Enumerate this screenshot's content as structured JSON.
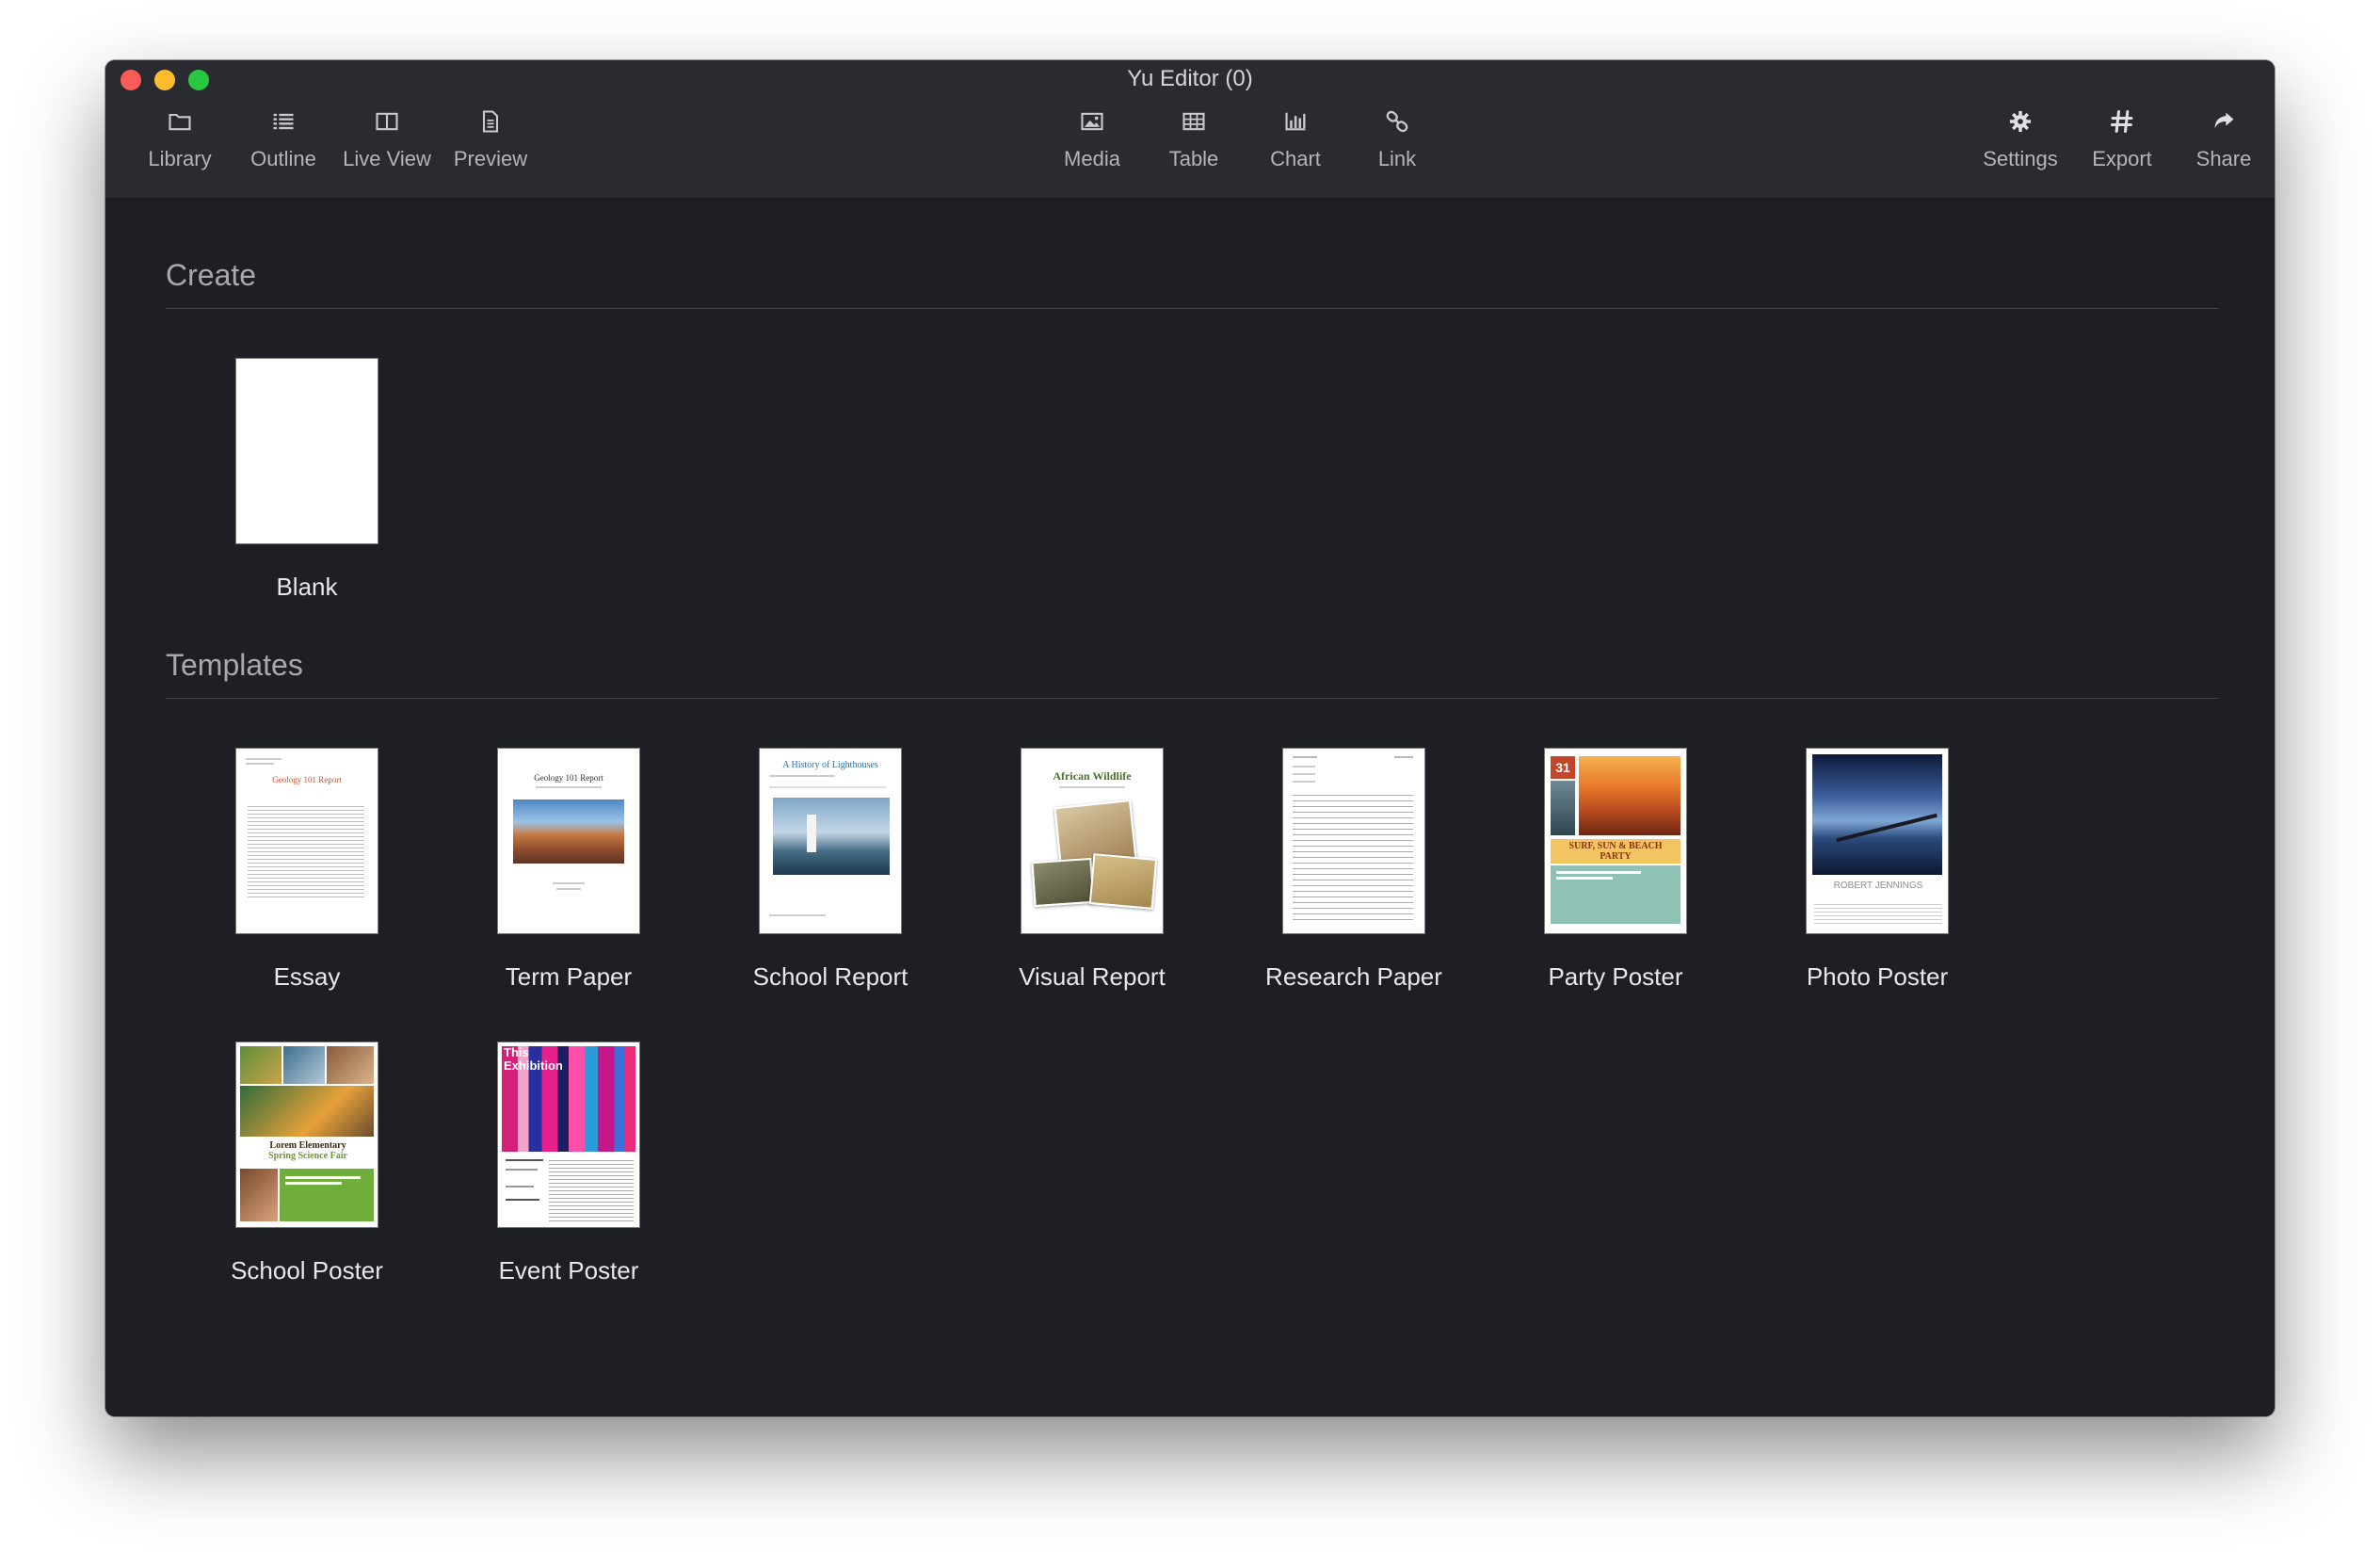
{
  "window": {
    "title": "Yu Editor (0)"
  },
  "toolbar": {
    "left": [
      {
        "label": "Library",
        "icon": "folder-icon"
      },
      {
        "label": "Outline",
        "icon": "outline-list-icon"
      },
      {
        "label": "Live View",
        "icon": "split-view-icon"
      },
      {
        "label": "Preview",
        "icon": "document-icon"
      }
    ],
    "center": [
      {
        "label": "Media",
        "icon": "image-icon"
      },
      {
        "label": "Table",
        "icon": "table-icon"
      },
      {
        "label": "Chart",
        "icon": "bar-chart-icon"
      },
      {
        "label": "Link",
        "icon": "link-icon"
      }
    ],
    "right": [
      {
        "label": "Settings",
        "icon": "gear-icon"
      },
      {
        "label": "Export",
        "icon": "hash-icon"
      },
      {
        "label": "Share",
        "icon": "share-arrow-icon"
      }
    ]
  },
  "create": {
    "title": "Create",
    "items": [
      {
        "label": "Blank"
      }
    ]
  },
  "templates": {
    "title": "Templates",
    "items": [
      {
        "label": "Essay",
        "thumb_text": [
          "Geology 101 Report"
        ]
      },
      {
        "label": "Term Paper",
        "thumb_text": [
          "Geology 101 Report"
        ]
      },
      {
        "label": "School Report",
        "thumb_text": [
          "A History of Lighthouses"
        ]
      },
      {
        "label": "Visual Report",
        "thumb_text": [
          "African Wildlife"
        ]
      },
      {
        "label": "Research Paper",
        "thumb_text": []
      },
      {
        "label": "Party Poster",
        "thumb_text": [
          "31",
          "SURF, SUN & BEACH PARTY"
        ]
      },
      {
        "label": "Photo Poster",
        "thumb_text": [
          "ROBERT JENNINGS"
        ]
      },
      {
        "label": "School Poster",
        "thumb_text": [
          "Lorem Elementary",
          "Spring Science Fair"
        ]
      },
      {
        "label": "Event Poster",
        "thumb_text": [
          "This",
          "Exhibition"
        ]
      }
    ]
  },
  "colors": {
    "window_bg": "#1e1f24",
    "toolbar_bg": "#2a2b30",
    "close": "#fc5b57",
    "minimize": "#fdbc2e",
    "zoom": "#27c840"
  }
}
